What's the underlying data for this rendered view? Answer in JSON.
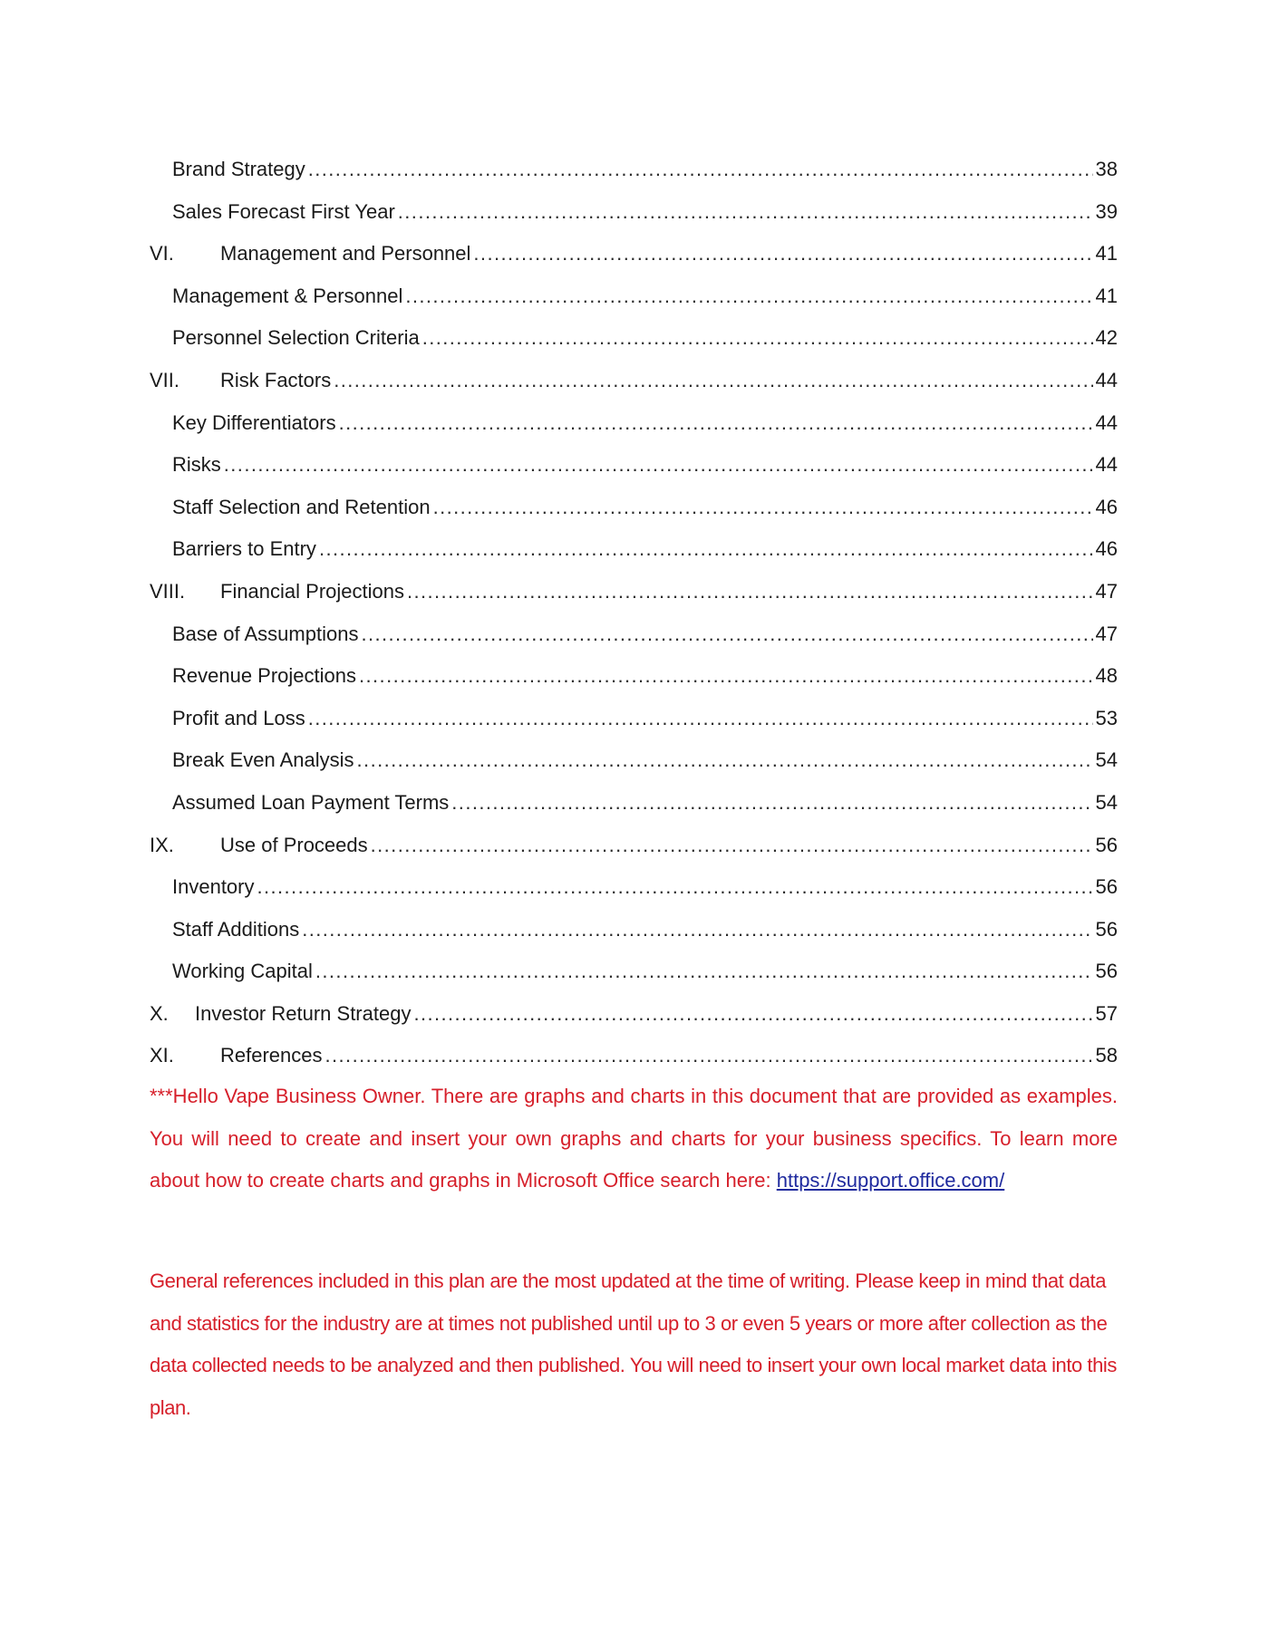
{
  "toc": {
    "entries": [
      {
        "number": "",
        "title": "Brand Strategy",
        "page": "38",
        "level": "sub"
      },
      {
        "number": "",
        "title": "Sales Forecast First Year",
        "page": "39",
        "level": "sub"
      },
      {
        "number": "VI.",
        "title": "Management and Personnel",
        "page": "41",
        "level": "section"
      },
      {
        "number": "",
        "title": "Management & Personnel",
        "page": "41",
        "level": "sub"
      },
      {
        "number": "",
        "title": "Personnel Selection Criteria",
        "page": "42",
        "level": "sub"
      },
      {
        "number": "VII.",
        "title": "Risk Factors",
        "page": "44",
        "level": "section"
      },
      {
        "number": "",
        "title": "Key Differentiators",
        "page": "44",
        "level": "sub"
      },
      {
        "number": "",
        "title": "Risks",
        "page": "44",
        "level": "sub"
      },
      {
        "number": "",
        "title": "Staff Selection and Retention",
        "page": "46",
        "level": "sub"
      },
      {
        "number": "",
        "title": "Barriers to Entry",
        "page": "46",
        "level": "sub"
      },
      {
        "number": "VIII.",
        "title": "Financial Projections",
        "page": "47",
        "level": "section"
      },
      {
        "number": "",
        "title": "Base of Assumptions",
        "page": "47",
        "level": "sub"
      },
      {
        "number": "",
        "title": "Revenue Projections",
        "page": "48",
        "level": "sub"
      },
      {
        "number": "",
        "title": "Profit and Loss",
        "page": "53",
        "level": "sub"
      },
      {
        "number": "",
        "title": "Break Even Analysis",
        "page": "54",
        "level": "sub"
      },
      {
        "number": "",
        "title": "Assumed Loan Payment Terms",
        "page": "54",
        "level": "sub"
      },
      {
        "number": "IX.",
        "title": "Use of Proceeds",
        "page": "56",
        "level": "section"
      },
      {
        "number": "",
        "title": "Inventory",
        "page": "56",
        "level": "sub"
      },
      {
        "number": "",
        "title": "Staff Additions",
        "page": "56",
        "level": "sub"
      },
      {
        "number": "",
        "title": "Working Capital",
        "page": "56",
        "level": "sub"
      },
      {
        "number": "X.",
        "title": "Investor Return Strategy",
        "page": "57",
        "level": "section-x"
      },
      {
        "number": "XI.",
        "title": "References",
        "page": "58",
        "level": "section"
      }
    ]
  },
  "notes": {
    "note1_text": "***Hello Vape Business Owner. There are graphs and charts in this document that are provided as examples. You will need to create and insert your own graphs and charts for your business specifics. To learn more about how to create charts and graphs in Microsoft Office search here: ",
    "note1_link": "https://support.office.com/",
    "note2_text": "General references included in this plan are the most updated at the time of writing.  Please keep in mind that data and statistics for the industry are at times not published until up to 3 or even 5 years or more after collection as the data collected needs to be analyzed and then published.  You will need to insert your own local market data into this plan.",
    "text_color": "#d61f2a",
    "link_color": "#1f2a9e"
  }
}
